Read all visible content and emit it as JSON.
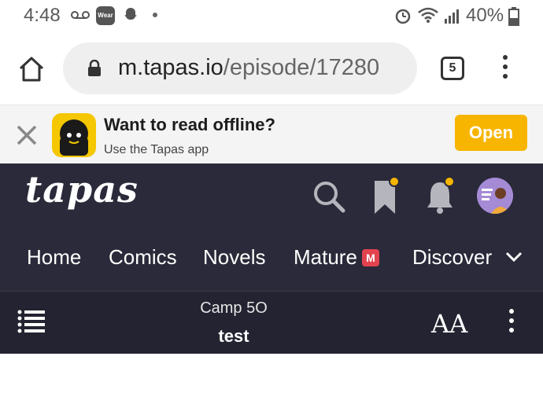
{
  "status_bar": {
    "time": "4:48",
    "wear_label": "Wear",
    "battery_text": "40%"
  },
  "browser": {
    "url_host": "m.tapas.io",
    "url_path": "/episode/17280",
    "tab_count": "5"
  },
  "app_banner": {
    "title": "Want to read offline?",
    "subtitle": "Use the Tapas app",
    "open_label": "Open"
  },
  "tapas_nav": {
    "logo": "tapas",
    "items": [
      {
        "label": "Home"
      },
      {
        "label": "Comics"
      },
      {
        "label": "Novels"
      },
      {
        "label": "Mature",
        "badge": "M"
      },
      {
        "label": "Discover"
      }
    ],
    "accent_color": "#f7b500",
    "header_color": "#2a2a3a"
  },
  "reader_bar": {
    "series": "Camp 5O",
    "episode": "test",
    "font_icon": "AA"
  }
}
